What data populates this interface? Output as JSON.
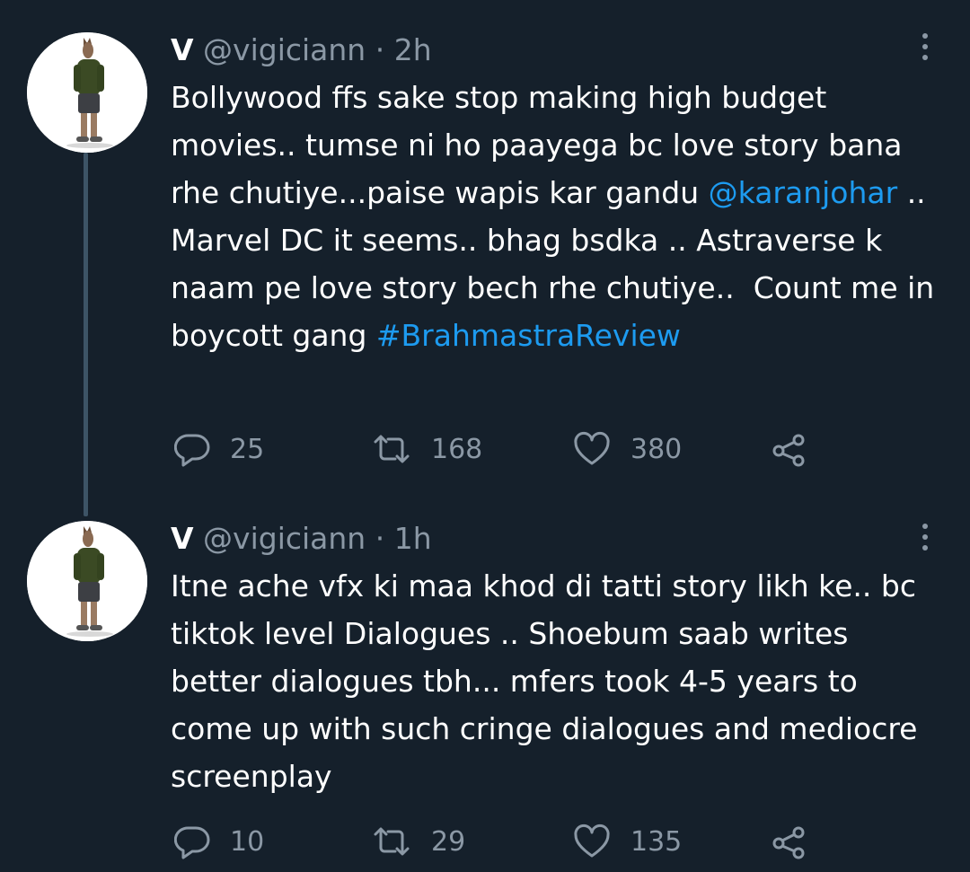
{
  "tweets": [
    {
      "name": "V",
      "handle": "@vigiciann",
      "separator": "·",
      "time": "2h",
      "text_parts": {
        "p1": "Bollywood ffs sake stop making high budget movies.. tumse ni ho paayega bc love story bana rhe chutiye...paise wapis kar gandu ",
        "mention": "@karanjohar",
        "p2": " .. Marvel DC it seems.. bhag bsdka .. Astraverse k naam pe love story bech rhe chutiye..  Count me in boycott gang ",
        "hashtag": "#BrahmastraReview"
      },
      "replies": "25",
      "retweets": "168",
      "likes": "380"
    },
    {
      "name": "V",
      "handle": "@vigiciann",
      "separator": "·",
      "time": "1h",
      "text": "Itne ache vfx ki maa khod di tatti story likh ke.. bc tiktok level Dialogues .. Shoebum saab writes better dialogues tbh... mfers took 4-5 years to come up with such cringe dialogues and mediocre screenplay",
      "replies": "10",
      "retweets": "29",
      "likes": "135"
    }
  ],
  "icons": {
    "reply": "reply-icon",
    "retweet": "retweet-icon",
    "like": "heart-icon",
    "share": "share-icon",
    "more": "more-vertical-icon"
  },
  "colors": {
    "background": "#15202b",
    "text": "#ffffff",
    "muted": "#8b98a5",
    "link": "#1d9bf0",
    "thread_line": "#3d5466"
  }
}
